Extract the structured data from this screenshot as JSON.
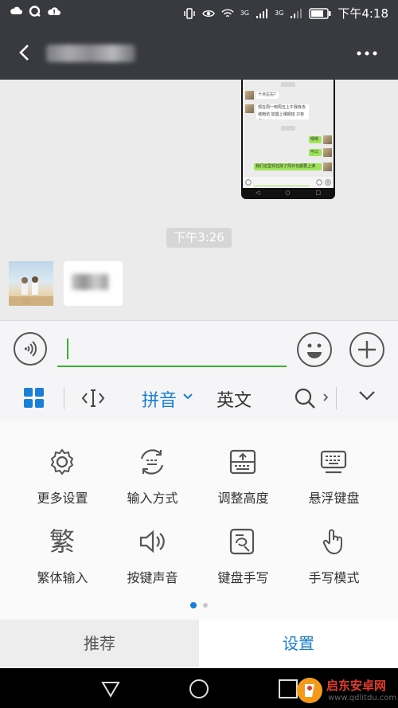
{
  "status_bar": {
    "network_small": "3G",
    "network_small2": "3G",
    "time": "下午4:18"
  },
  "title_bar": {
    "contact_name": "",
    "colors": {
      "bg": "#393a3f"
    }
  },
  "chat": {
    "timestamp": "下午3:26",
    "screenshot_messages": [
      {
        "side": "left",
        "text": "十点左右?"
      },
      {
        "side": "left",
        "text": "现在周一到周五上午我有去城南坊 加盟上课报班 只有周末才有空"
      },
      {
        "side": "right",
        "text": "嗯嗯"
      },
      {
        "side": "right",
        "text": "可以"
      },
      {
        "side": "right",
        "text": "我们这里现在除了周日也都要上课"
      }
    ],
    "message_text": ""
  },
  "input_bar": {
    "value": "",
    "accent": "#3cb034"
  },
  "keyboard_toolbar": {
    "pinyin": "拼音",
    "english": "英文",
    "accent": "#1a7fd6"
  },
  "panel": {
    "items": [
      {
        "label": "更多设置",
        "icon": "gear-icon"
      },
      {
        "label": "输入方式",
        "icon": "input-method-icon"
      },
      {
        "label": "调整高度",
        "icon": "adjust-height-icon"
      },
      {
        "label": "悬浮键盘",
        "icon": "floating-keyboard-icon"
      },
      {
        "label": "繁体输入",
        "icon": "traditional-icon",
        "glyph": "繁"
      },
      {
        "label": "按键声音",
        "icon": "speaker-icon"
      },
      {
        "label": "键盘手写",
        "icon": "keyboard-handwriting-icon"
      },
      {
        "label": "手写模式",
        "icon": "handwriting-mode-icon"
      }
    ],
    "page": 1,
    "pages": 2
  },
  "bottom_tabs": {
    "recommend": "推荐",
    "settings": "设置",
    "active": "settings"
  },
  "watermark": {
    "title": "启东安卓网",
    "url": "www.qdlitdu.com"
  }
}
